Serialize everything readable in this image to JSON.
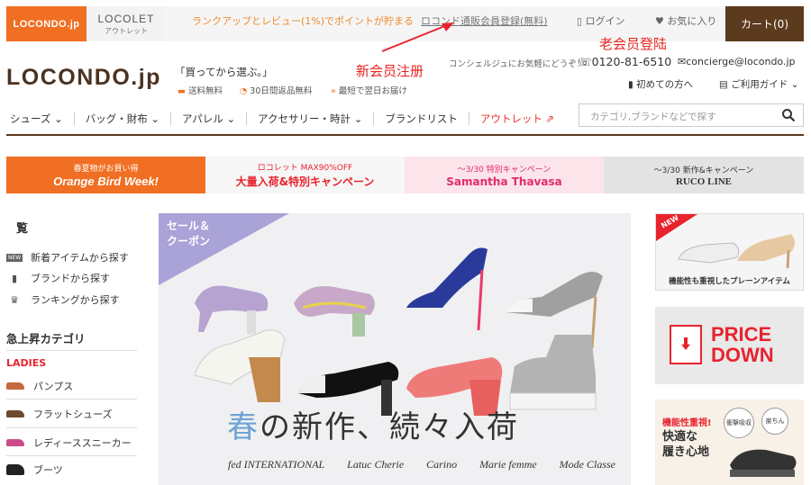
{
  "header": {
    "locondo_tab": "LOCONDO.jp",
    "locolet_tab": "LOCOLET",
    "locolet_sub": "アウトレット",
    "promo": "ランクアップとレビュー(1%)でポイントが貯まる",
    "signup": "ロコンド通販会員登録(無料)",
    "login": "ログイン",
    "favorites": "お気に入り",
    "cart": "カート(0)"
  },
  "annotations": {
    "new_member": "新会员注册",
    "old_member": "老会员登陆"
  },
  "logo": "LOCONDO.jp",
  "tagline": "「買ってから選ぶ。」",
  "features": [
    "送料無料",
    "30日間返品無料",
    "最短で翌日お届け"
  ],
  "contact": {
    "concierge": "コンシェルジュにお気軽にどうぞ！",
    "phone": "0120-81-6510",
    "email": "concierge@locondo.jp",
    "beginner": "初めての方へ",
    "guide": "ご利用ガイド"
  },
  "nav": [
    "シューズ",
    "バッグ・財布",
    "アパレル",
    "アクセサリー・時計",
    "ブランドリスト",
    "アウトレット"
  ],
  "search_placeholder": "カテゴリ,ブランドなどで探す",
  "banners": [
    {
      "line1": "春夏物がお買い得",
      "line2": "Orange Bird Week!"
    },
    {
      "line1": "ロコレット MAX90%OFF",
      "line2": "大量入荷&特別キャンペーン"
    },
    {
      "line1": "～3/30 特別キャンペーン",
      "line2": "Samantha Thavasa"
    },
    {
      "line1": "～3/30 新作&キャンペーン",
      "line2": "RUCO LINE"
    }
  ],
  "sidebar": {
    "title": "覧",
    "new_tag": "NEW",
    "items": [
      "新着アイテムから探す",
      "ブランドから探す",
      "ランキングから探す"
    ],
    "section_title": "急上昇カテゴリ",
    "ladies": "LADIES",
    "categories": [
      "パンプス",
      "フラットシューズ",
      "レディーススニーカー",
      "ブーツ"
    ]
  },
  "hero": {
    "badge_line1": "セール＆",
    "badge_line2": "クーポン",
    "head_blue": "春",
    "head_rest": "の新作、続々入荷",
    "brands": [
      "fed INTERNATIONAL",
      "Latuc Cherie",
      "Carino",
      "Marie femme",
      "Mode Classe"
    ]
  },
  "ads": {
    "new_tag": "NEW",
    "ad1_caption": "機能性も重視したプレーンアイテム",
    "ad2_line1": "PRICE",
    "ad2_line2": "DOWN",
    "ad3_line1": "機能性重視!",
    "ad3_line2": "快適な",
    "ad3_line3": "履き心地",
    "ad3_circle1": "衝撃吸収",
    "ad3_circle2": "楽ちん"
  }
}
